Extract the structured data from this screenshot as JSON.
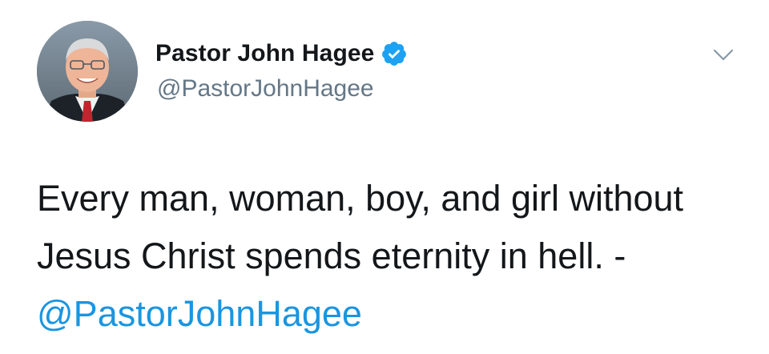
{
  "tweet": {
    "author": {
      "display_name": "Pastor John Hagee",
      "handle": "@PastorJohnHagee",
      "verified": true,
      "avatar_icon": "avatar-photo"
    },
    "text_lines": [
      "Every man, woman, boy, and girl without",
      "Jesus Christ spends eternity in hell. -"
    ],
    "mention": "@PastorJohnHagee",
    "menu_icon": "chevron-down-icon"
  },
  "colors": {
    "text": "#14171a",
    "secondary_text": "#657786",
    "link": "#1b95e0",
    "verified_badge": "#1da1f2",
    "background": "#ffffff"
  }
}
